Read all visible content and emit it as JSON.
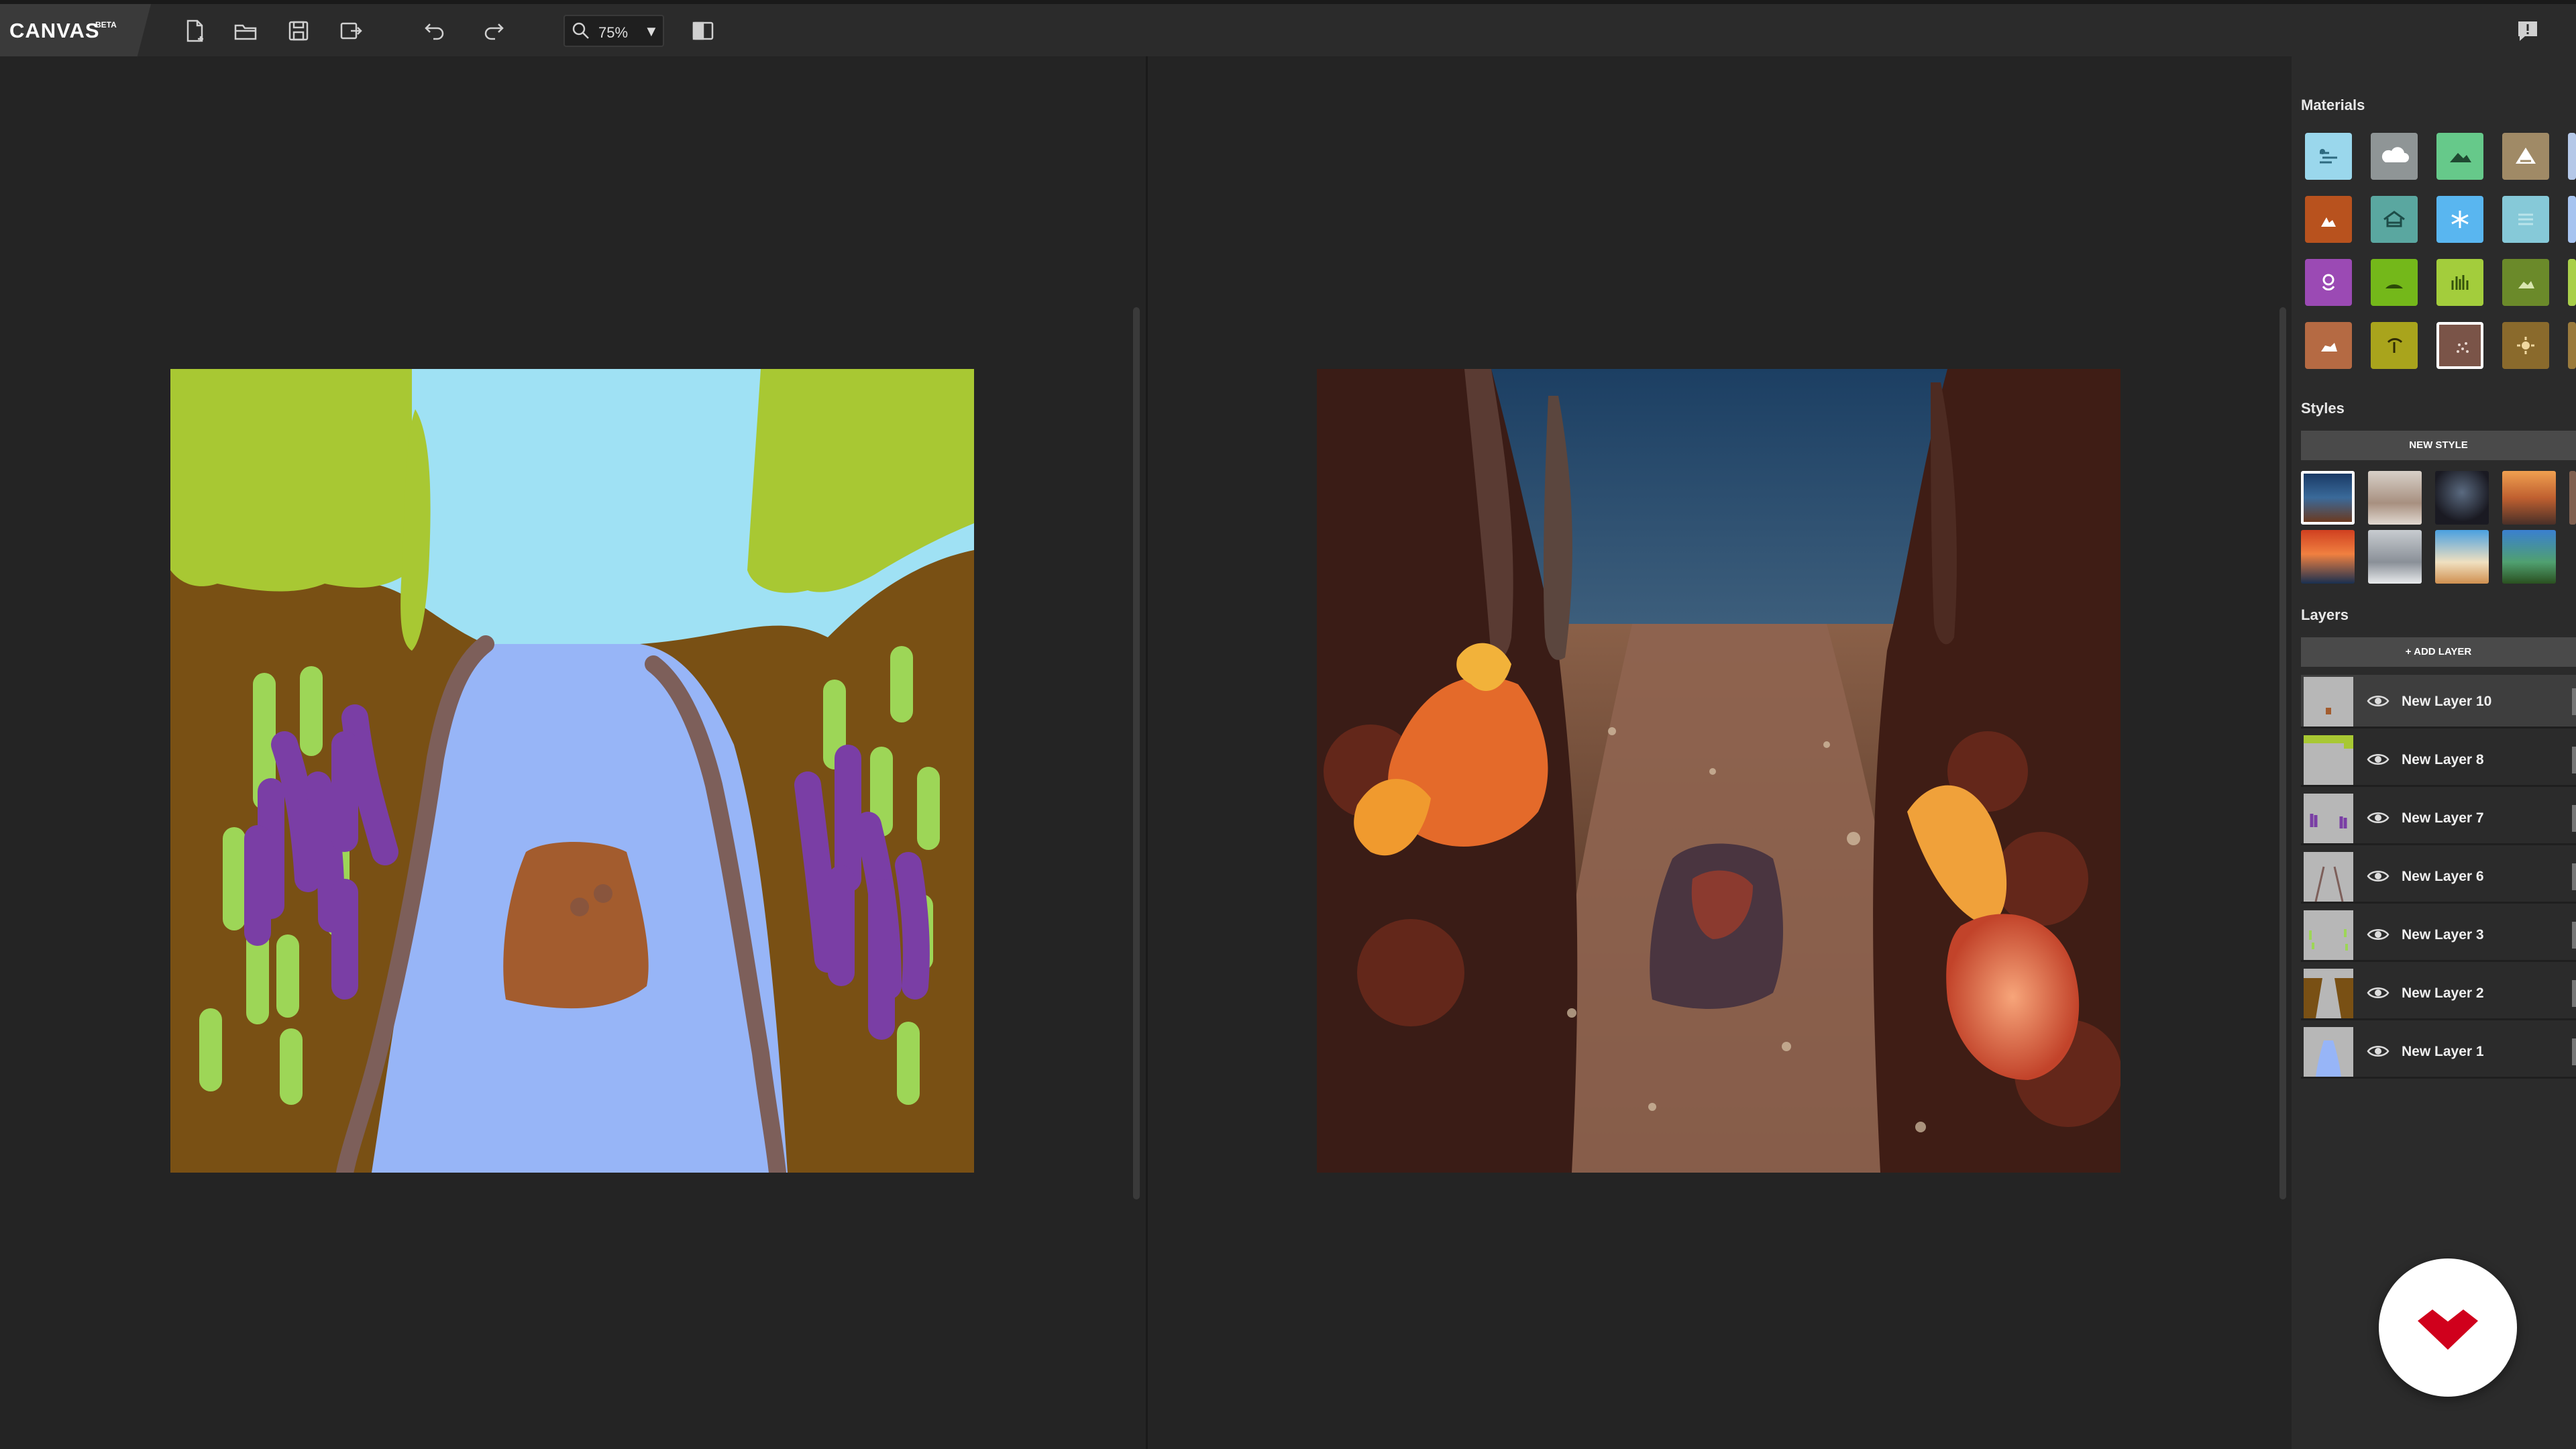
{
  "app": {
    "name": "CANVAS",
    "tag": "BETA"
  },
  "toolbar": {
    "zoom_label": "75%",
    "zoom_caret": "▼",
    "icons": [
      "new-file-icon",
      "open-folder-icon",
      "save-icon",
      "export-icon",
      "undo-icon",
      "redo-icon",
      "zoom-icon",
      "split-view-icon",
      "feedback-icon"
    ]
  },
  "panel": {
    "materials_title": "Materials",
    "styles_title": "Styles",
    "new_style_label": "NEW STYLE",
    "layers_title": "Layers",
    "add_layer_label": "+ ADD LAYER",
    "materials": [
      {
        "name": "sky",
        "color": "#9ad7ec"
      },
      {
        "name": "cloud",
        "color": "#8f9596"
      },
      {
        "name": "hill",
        "color": "#66c98a"
      },
      {
        "name": "mountain",
        "color": "#a08a66"
      },
      {
        "name": "dirt",
        "color": "#b8521e"
      },
      {
        "name": "house",
        "color": "#5aa7a0"
      },
      {
        "name": "snow",
        "color": "#59b6f0"
      },
      {
        "name": "fog",
        "color": "#86c9d8"
      },
      {
        "name": "flower",
        "color": "#9b4ab4"
      },
      {
        "name": "grass",
        "color": "#74b81a"
      },
      {
        "name": "bush",
        "color": "#a3cd3c"
      },
      {
        "name": "rock-grass",
        "color": "#6b8a2a"
      },
      {
        "name": "stone",
        "color": "#b56a43"
      },
      {
        "name": "tree",
        "color": "#a9a41c"
      },
      {
        "name": "sparkle",
        "color": "#7a5448"
      },
      {
        "name": "sun",
        "color": "#8a6a2c"
      }
    ],
    "layers": [
      {
        "name": "New Layer 10",
        "active": true
      },
      {
        "name": "New Layer 8",
        "active": false
      },
      {
        "name": "New Layer 7",
        "active": false
      },
      {
        "name": "New Layer 6",
        "active": false
      },
      {
        "name": "New Layer 3",
        "active": false
      },
      {
        "name": "New Layer 2",
        "active": false
      },
      {
        "name": "New Layer 1",
        "active": false
      }
    ]
  }
}
